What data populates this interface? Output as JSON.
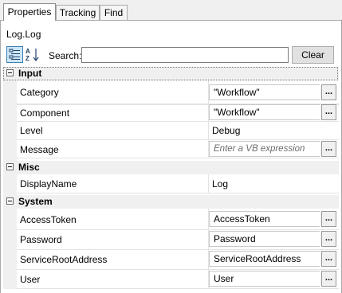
{
  "tabs": [
    {
      "label": "Properties",
      "active": true
    },
    {
      "label": "Tracking",
      "active": false
    },
    {
      "label": "Find",
      "active": false
    }
  ],
  "activity_title": "Log.Log",
  "toolbar": {
    "categorized_icon": "categorized-view-icon",
    "alphabetical_icon": "sort-alphabetical-icon",
    "search_label": "Search:",
    "search_value": "",
    "clear_label": "Clear"
  },
  "categories": [
    {
      "name": "Input",
      "properties": [
        {
          "name": "Category",
          "value": "\"Workflow\"",
          "kind": "expression"
        },
        {
          "name": "Component",
          "value": "\"Workflow\"",
          "kind": "expression"
        },
        {
          "name": "Level",
          "value": "Debug",
          "kind": "plain"
        },
        {
          "name": "Message",
          "value": "",
          "placeholder": "Enter a VB expression",
          "kind": "expression"
        }
      ]
    },
    {
      "name": "Misc",
      "properties": [
        {
          "name": "DisplayName",
          "value": "Log",
          "kind": "plain"
        }
      ]
    },
    {
      "name": "System",
      "properties": [
        {
          "name": "AccessToken",
          "value": "AccessToken",
          "kind": "expression"
        },
        {
          "name": "Password",
          "value": "Password",
          "kind": "expression"
        },
        {
          "name": "ServiceRootAddress",
          "value": "ServiceRootAddress",
          "kind": "expression"
        },
        {
          "name": "User",
          "value": "User",
          "kind": "expression"
        }
      ]
    }
  ],
  "ellipsis_label": "...",
  "colors": {
    "panel_border": "#a9a9a9",
    "category_bg": "#f0f0f0",
    "selected_tool_bg": "#cde6f7",
    "selected_tool_border": "#3c7fb1",
    "placeholder_text": "#6d6d6d"
  }
}
